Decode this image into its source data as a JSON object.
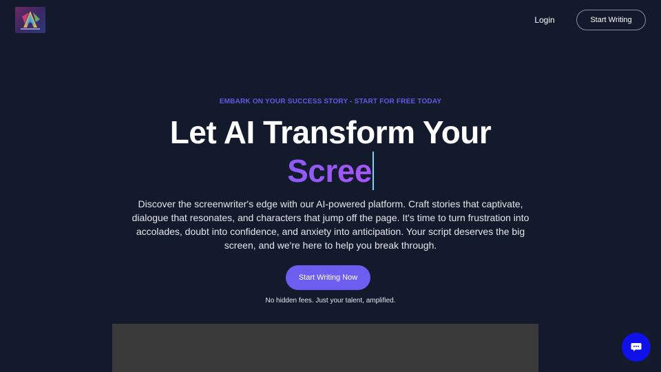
{
  "header": {
    "logo_icon": "brand-logo-icon",
    "login_label": "Login",
    "start_writing_label": "Start Writing"
  },
  "hero": {
    "eyebrow": "EMBARK ON YOUR SUCCESS STORY - START FOR FREE TODAY",
    "headline": "Let AI Transform Your",
    "typed_text": "Scree",
    "description": "Discover the screenwriter's edge with our AI-powered platform. Craft stories that captivate, dialogue that resonates, and characters that jump off the page. It's time to turn frustration into accolades, doubt into confidence, and anxiety into anticipation. Your script deserves the big screen, and we're here to help you break through.",
    "cta_label": "Start Writing Now",
    "subnote": "No hidden fees. Just your talent, amplified."
  },
  "chat": {
    "icon": "chat-bubble-icon"
  },
  "colors": {
    "background": "#121a2b",
    "accent": "#6d5ef0",
    "eyebrow": "#5b5ce6",
    "typed_gradient_start": "#8b5cf6",
    "typed_gradient_end": "#a855f7",
    "caret": "#7dd3fc",
    "chat_button": "#1010e8",
    "media_panel": "#3a3a3a"
  }
}
